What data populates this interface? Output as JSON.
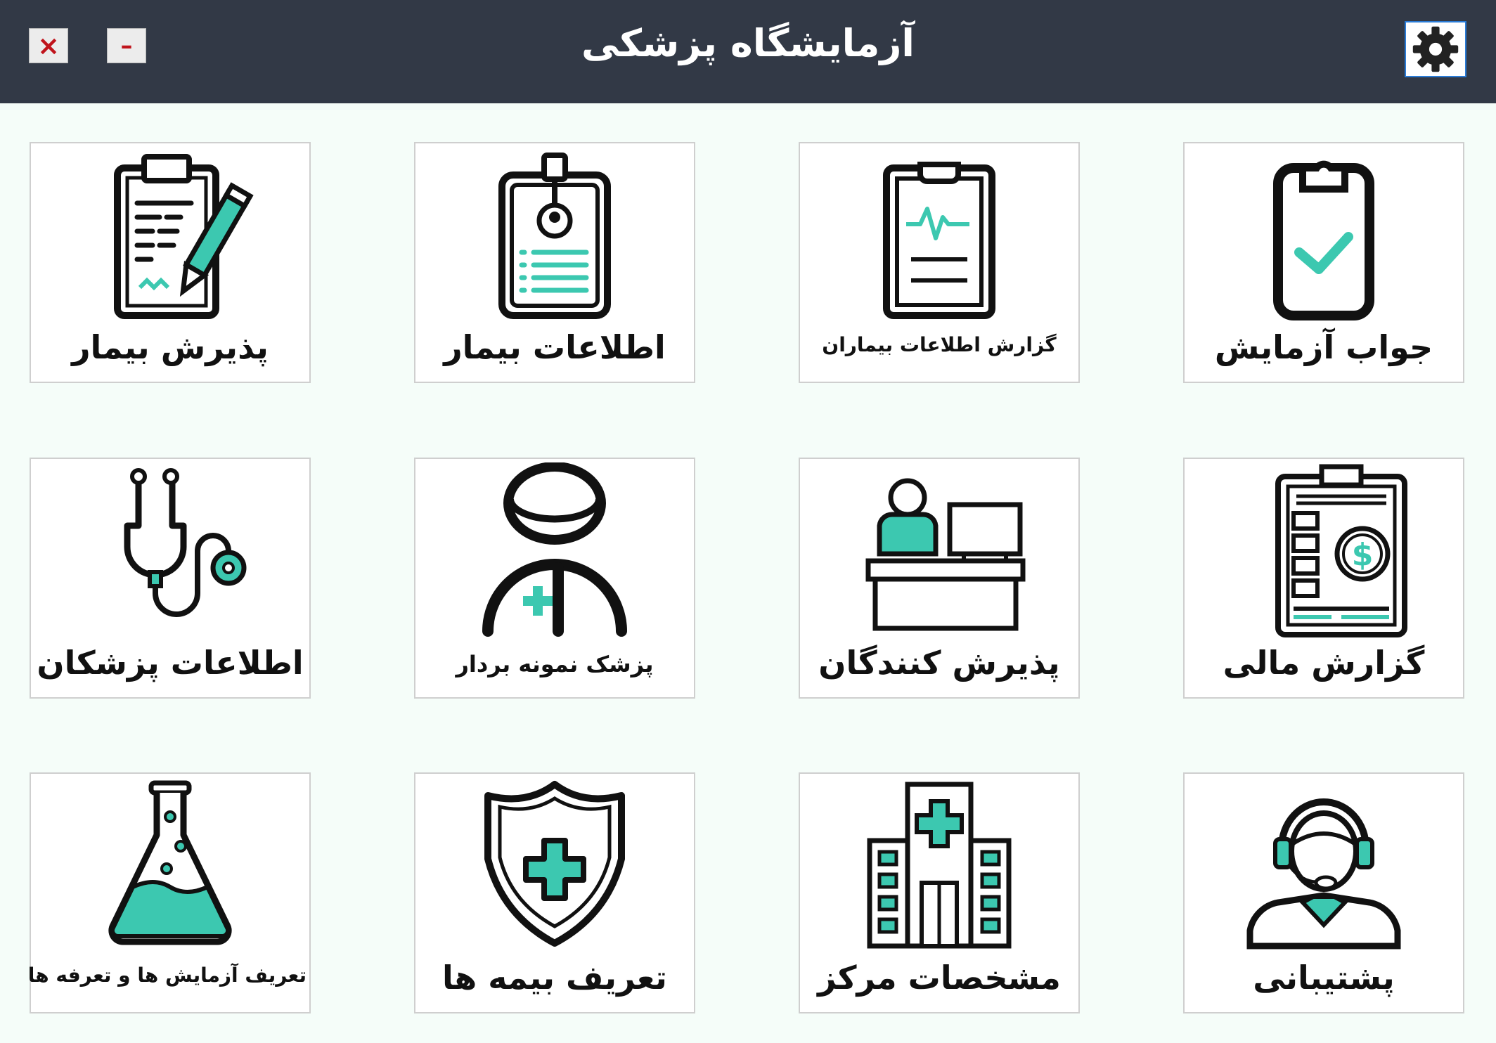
{
  "window": {
    "title": "آزمایشگاه پزشکی",
    "close_symbol": "×",
    "minimize_symbol": "–",
    "settings_icon": "gear-icon"
  },
  "colors": {
    "titlebar": "#323946",
    "accent": "#3cc8b0",
    "background": "#f5fdf9"
  },
  "tiles": [
    {
      "label": "جواب آزمایش",
      "icon": "clipboard-check-icon"
    },
    {
      "label": "گزارش اطلاعات بیماران",
      "icon": "clipboard-heartbeat-icon"
    },
    {
      "label": "اطلاعات بیمار",
      "icon": "patient-id-badge-icon"
    },
    {
      "label": "پذیرش بیمار",
      "icon": "clipboard-pen-icon"
    },
    {
      "label": "گزارش مالی",
      "icon": "financial-report-icon"
    },
    {
      "label": "پذیرش کنندگان",
      "icon": "reception-desk-icon"
    },
    {
      "label": "پزشک نمونه بردار",
      "icon": "doctor-icon"
    },
    {
      "label": "اطلاعات پزشکان",
      "icon": "stethoscope-icon"
    },
    {
      "label": "پشتیبانی",
      "icon": "support-agent-icon"
    },
    {
      "label": "مشخصات مرکز",
      "icon": "hospital-building-icon"
    },
    {
      "label": "تعریف بیمه ها",
      "icon": "insurance-shield-icon"
    },
    {
      "label": "تعریف آزمایش ها و تعرفه ها",
      "icon": "lab-flask-icon"
    }
  ]
}
